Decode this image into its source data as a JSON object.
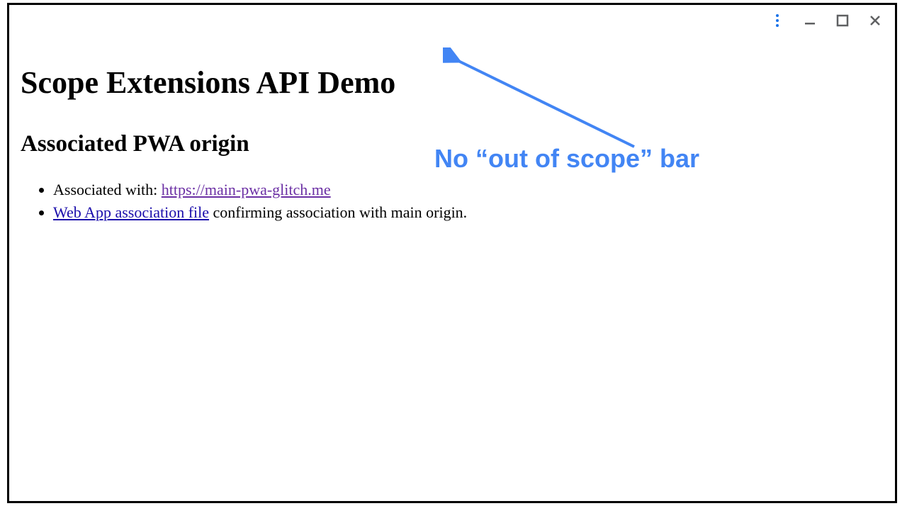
{
  "titlebar": {
    "kebab_name": "kebab-menu-icon",
    "minimize_name": "minimize-icon",
    "maximize_name": "maximize-icon",
    "close_name": "close-icon"
  },
  "page": {
    "title": "Scope Extensions API Demo",
    "section_heading": "Associated PWA origin",
    "bullets": {
      "associated_prefix": "Associated with: ",
      "associated_link_text": "https://main-pwa-glitch.me",
      "assoc_file_link_text": "Web App association file",
      "assoc_file_suffix": " confirming association with main origin."
    }
  },
  "annotation": {
    "text": "No “out of scope” bar",
    "color": "#4285f4"
  }
}
